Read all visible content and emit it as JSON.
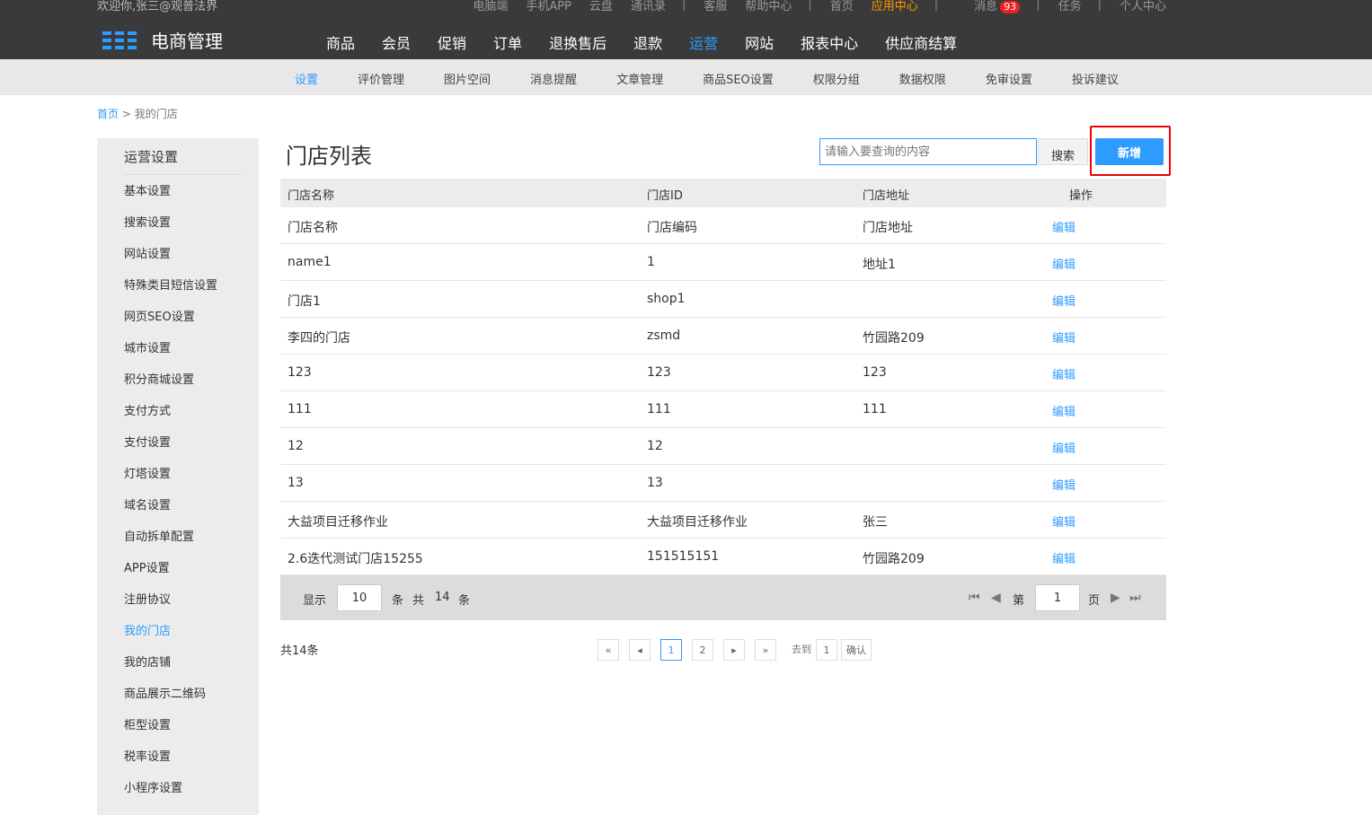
{
  "topbar": {
    "welcome": "欢迎你,张三@观普法界",
    "links": [
      "电脑端",
      "手机APP",
      "云盘",
      "通讯录"
    ],
    "links2": [
      "客服",
      "帮助中心"
    ],
    "home": "首页",
    "app_center": "应用中心",
    "messages": "消息",
    "message_count": "93",
    "tasks": "任务",
    "profile": "个人中心"
  },
  "logo": {
    "text": "电商管理"
  },
  "mainnav": [
    "商品",
    "会员",
    "促销",
    "订单",
    "退换售后",
    "退款",
    "运营",
    "网站",
    "报表中心",
    "供应商结算"
  ],
  "subnav": [
    "设置",
    "评价管理",
    "图片空间",
    "消息提醒",
    "文章管理",
    "商品SEO设置",
    "权限分组",
    "数据权限",
    "免审设置",
    "投诉建议"
  ],
  "breadcrumb": {
    "home": "首页",
    "sep": ">",
    "current": "我的门店"
  },
  "sidebar": {
    "title": "运营设置",
    "items": [
      "基本设置",
      "搜索设置",
      "网站设置",
      "特殊类目短信设置",
      "网页SEO设置",
      "城市设置",
      "积分商城设置",
      "支付方式",
      "支付设置",
      "灯塔设置",
      "域名设置",
      "自动拆单配置",
      "APP设置",
      "注册协议",
      "我的门店",
      "我的店铺",
      "商品展示二维码",
      "柜型设置",
      "税率设置",
      "小程序设置"
    ]
  },
  "main": {
    "title": "门店列表",
    "search_placeholder": "请输入要查询的内容",
    "search_label": "搜索",
    "add_label": "新增"
  },
  "table": {
    "headers": [
      "门店名称",
      "门店ID",
      "门店地址",
      "操作"
    ],
    "rows": [
      [
        "门店名称",
        "门店编码",
        "门店地址",
        "编辑"
      ],
      [
        "name1",
        "1",
        "地址1",
        "编辑"
      ],
      [
        "门店1",
        "shop1",
        "",
        "编辑"
      ],
      [
        "李四的门店",
        "zsmd",
        "竹园路209",
        "编辑"
      ],
      [
        "123",
        "123",
        "123",
        "编辑"
      ],
      [
        "111",
        "111",
        "111",
        "编辑"
      ],
      [
        "12",
        "12",
        "",
        "编辑"
      ],
      [
        "13",
        "13",
        "",
        "编辑"
      ],
      [
        "大益项目迁移作业",
        "大益项目迁移作业",
        "张三",
        "编辑"
      ],
      [
        "2.6迭代测试门店15255",
        "151515151",
        "竹园路209",
        "编辑"
      ]
    ]
  },
  "footer_bar": {
    "show": "显示",
    "page_size": "10",
    "unit": "条",
    "total_prefix": "共",
    "total": "14",
    "total_suffix": "条",
    "page_prefix": "第",
    "page": "1",
    "page_suffix": "页"
  },
  "pager": {
    "total_text": "共14条",
    "first": "«",
    "prev": "◂",
    "pages": [
      "1",
      "2"
    ],
    "next": "▸",
    "last": "»",
    "goto": "去到",
    "goto_value": "1",
    "confirm": "确认"
  }
}
